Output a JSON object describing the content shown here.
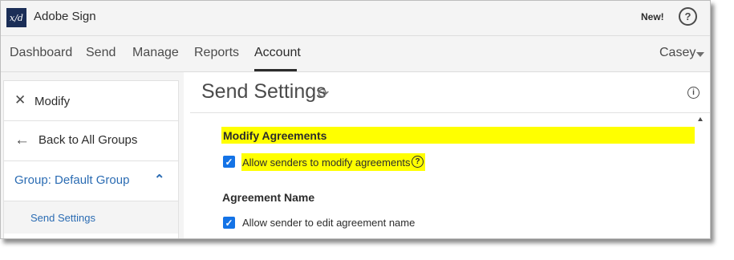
{
  "app": {
    "logo_text": "x/d",
    "title": "Adobe Sign",
    "new_label": "New!",
    "help_glyph": "?"
  },
  "nav": {
    "items": [
      {
        "label": "Dashboard"
      },
      {
        "label": "Send"
      },
      {
        "label": "Manage"
      },
      {
        "label": "Reports"
      },
      {
        "label": "Account",
        "active": true
      }
    ],
    "user": "Casey"
  },
  "sidebar": {
    "close_label": "Modify",
    "back_label": "Back to All Groups",
    "group_label": "Group: Default Group",
    "sub_item": "Send Settings"
  },
  "main": {
    "title": "Send Settings",
    "sections": [
      {
        "title": "Modify Agreements",
        "highlighted": true,
        "option": {
          "label": "Allow senders to modify agreements",
          "checked": true,
          "help_glyph": "?"
        }
      },
      {
        "title": "Agreement Name",
        "option": {
          "label": "Allow sender to edit agreement name",
          "checked": true
        }
      }
    ]
  },
  "colors": {
    "accent": "#1473e6",
    "link": "#2b6cb3",
    "highlight": "#ffff00",
    "logo_bg": "#1b2e57"
  }
}
